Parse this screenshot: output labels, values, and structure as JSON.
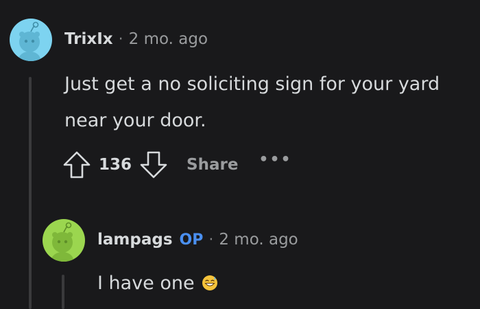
{
  "comments": [
    {
      "username": "TrixIx",
      "separator": "·",
      "time": "2 mo. ago",
      "body_lines": [
        "Just get a no soliciting sign for your yard",
        "near your door."
      ],
      "score": "136",
      "share_label": "Share",
      "more_label": "•••",
      "avatar_color": "#7dd3f0"
    },
    {
      "username": "lampags",
      "op_badge": "OP",
      "separator": "·",
      "time": "2 mo. ago",
      "body": "I have one",
      "avatar_color": "#9bd64f"
    }
  ],
  "icons": {
    "upvote": "upvote-arrow-icon",
    "downvote": "downvote-arrow-icon",
    "emoji": "grinning-sweat-emoji"
  },
  "colors": {
    "background": "#19191b",
    "text": "#d7dadc",
    "muted": "#9a9c9e",
    "op": "#4a8ff0",
    "thread_line": "#3a3a3c"
  }
}
